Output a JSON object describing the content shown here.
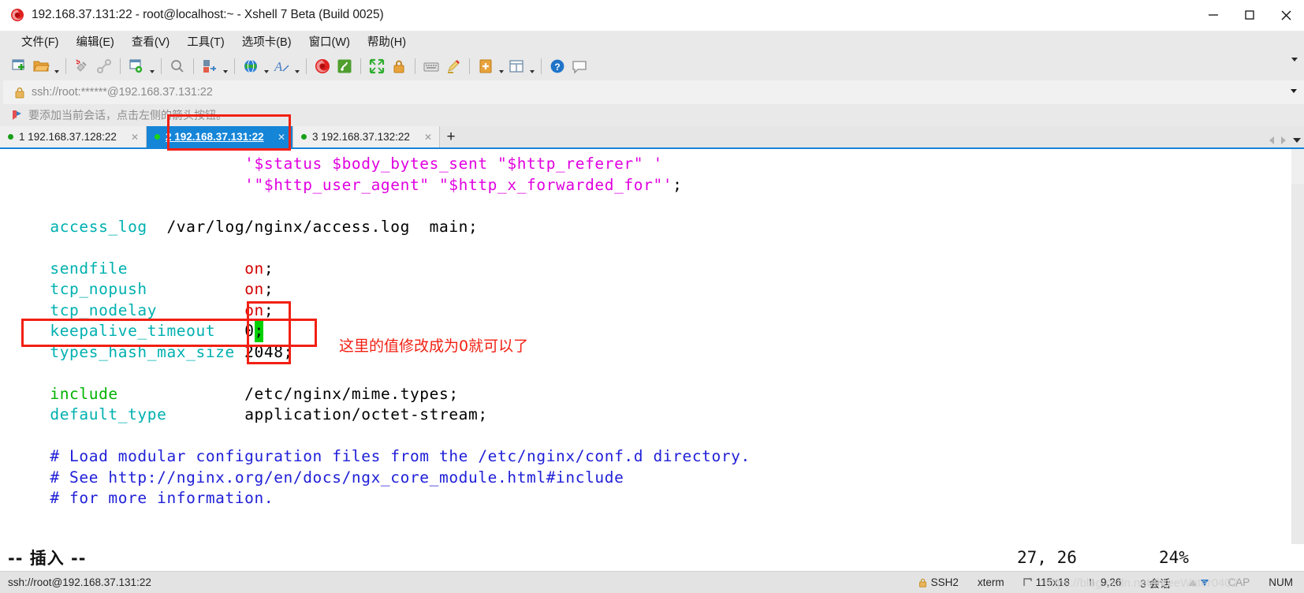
{
  "window": {
    "title": "192.168.37.131:22 - root@localhost:~ - Xshell 7 Beta (Build 0025)",
    "logo_icon": "xshell-spiral-logo",
    "minimize_label": "—",
    "maximize_label": "□",
    "close_label": "✕"
  },
  "menu": {
    "items": [
      {
        "label": "文件(F)",
        "name": "menu-file"
      },
      {
        "label": "编辑(E)",
        "name": "menu-edit"
      },
      {
        "label": "查看(V)",
        "name": "menu-view"
      },
      {
        "label": "工具(T)",
        "name": "menu-tools"
      },
      {
        "label": "选项卡(B)",
        "name": "menu-tabs"
      },
      {
        "label": "窗口(W)",
        "name": "menu-window"
      },
      {
        "label": "帮助(H)",
        "name": "menu-help"
      }
    ]
  },
  "toolbar": {
    "icons": [
      "new-session-icon",
      "open-folder-icon",
      "disconnect-icon",
      "link-icon",
      "session-properties-icon",
      "find-icon",
      "transfer-icon",
      "globe-icon",
      "font-icon",
      "xshell-icon",
      "xftp-icon",
      "fullscreen-icon",
      "lock-icon",
      "keyboard-icon",
      "highlight-icon",
      "compose-icon",
      "layout-icon",
      "help-icon",
      "chat-icon"
    ]
  },
  "address": {
    "value": "ssh://root:******@192.168.37.131:22",
    "lock_icon": "lock-icon",
    "dropdown_icon": "chevron-down-icon"
  },
  "hint": {
    "icon": "bookmark-flag-icon",
    "text": "要添加当前会话，点击左侧的箭头按钮。"
  },
  "tabs": {
    "items": [
      {
        "num": "1",
        "label": "1 192.168.37.128:22",
        "active": false,
        "name": "tab-session-1"
      },
      {
        "num": "2",
        "label": "2 192.168.37.131:22",
        "active": true,
        "name": "tab-session-2"
      },
      {
        "num": "3",
        "label": "3 192.168.37.132:22",
        "active": false,
        "name": "tab-session-3"
      }
    ],
    "close_label": "✕",
    "add_label": "+"
  },
  "terminal": {
    "lines": [
      [
        {
          "t": "                        ",
          "c": "black"
        },
        {
          "t": "'$status $body_bytes_sent \"$http_referer\" '",
          "c": "magenta"
        }
      ],
      [
        {
          "t": "                        ",
          "c": "black"
        },
        {
          "t": "'\"$http_user_agent\" \"$http_x_forwarded_for\"'",
          "c": "magenta"
        },
        {
          "t": ";",
          "c": "black"
        }
      ],
      [],
      [
        {
          "t": "    ",
          "c": "black"
        },
        {
          "t": "access_log",
          "c": "cyan"
        },
        {
          "t": "  /var/log/nginx/access.log  main;",
          "c": "black"
        }
      ],
      [],
      [
        {
          "t": "    ",
          "c": "black"
        },
        {
          "t": "sendfile",
          "c": "cyan"
        },
        {
          "t": "            ",
          "c": "black"
        },
        {
          "t": "on",
          "c": "red"
        },
        {
          "t": ";",
          "c": "black"
        }
      ],
      [
        {
          "t": "    ",
          "c": "black"
        },
        {
          "t": "tcp_nopush",
          "c": "cyan"
        },
        {
          "t": "          ",
          "c": "black"
        },
        {
          "t": "on",
          "c": "red"
        },
        {
          "t": ";",
          "c": "black"
        }
      ],
      [
        {
          "t": "    ",
          "c": "black"
        },
        {
          "t": "tcp_nodelay",
          "c": "cyan"
        },
        {
          "t": "         ",
          "c": "black"
        },
        {
          "t": "on",
          "c": "red"
        },
        {
          "t": ";",
          "c": "black"
        }
      ],
      [
        {
          "t": "    ",
          "c": "black"
        },
        {
          "t": "keepalive_timeout",
          "c": "cyan"
        },
        {
          "t": "   ",
          "c": "black"
        },
        {
          "t": "0",
          "c": "black"
        },
        {
          "t": ";",
          "c": "cursor"
        }
      ],
      [
        {
          "t": "    ",
          "c": "black"
        },
        {
          "t": "types_hash_max_size",
          "c": "cyan"
        },
        {
          "t": " 2048;",
          "c": "black"
        }
      ],
      [],
      [
        {
          "t": "    ",
          "c": "black"
        },
        {
          "t": "include",
          "c": "green"
        },
        {
          "t": "             /etc/nginx/mime.types;",
          "c": "black"
        }
      ],
      [
        {
          "t": "    ",
          "c": "black"
        },
        {
          "t": "default_type",
          "c": "cyan"
        },
        {
          "t": "        application/octet-stream;",
          "c": "black"
        }
      ],
      [],
      [
        {
          "t": "    ",
          "c": "black"
        },
        {
          "t": "# Load modular configuration files from the /etc/nginx/conf.d directory.",
          "c": "blue"
        }
      ],
      [
        {
          "t": "    ",
          "c": "black"
        },
        {
          "t": "# See http://nginx.org/en/docs/ngx_core_module.html#include",
          "c": "blue"
        }
      ],
      [
        {
          "t": "    ",
          "c": "black"
        },
        {
          "t": "# for more information.",
          "c": "blue"
        }
      ]
    ],
    "vim_mode": "-- 插入 --",
    "vim_position": "27, 26",
    "vim_percent": "24%"
  },
  "annotations": {
    "note_text": "这里的值修改成为0就可以了",
    "color": "#f22013",
    "watermark": "https://blog.csdn.net/threeWater0402"
  },
  "statusbar": {
    "connection": "ssh://root@192.168.37.131:22",
    "protocol": "SSH2",
    "protocol_icon": "lock-icon",
    "terminal_type": "xterm",
    "size": "115x18",
    "size_icon": "resize-icon",
    "cursor": "9,26",
    "cursor_icon": "cursor-icon",
    "sessions": "3 会话",
    "cap": "CAP",
    "num": "NUM"
  }
}
